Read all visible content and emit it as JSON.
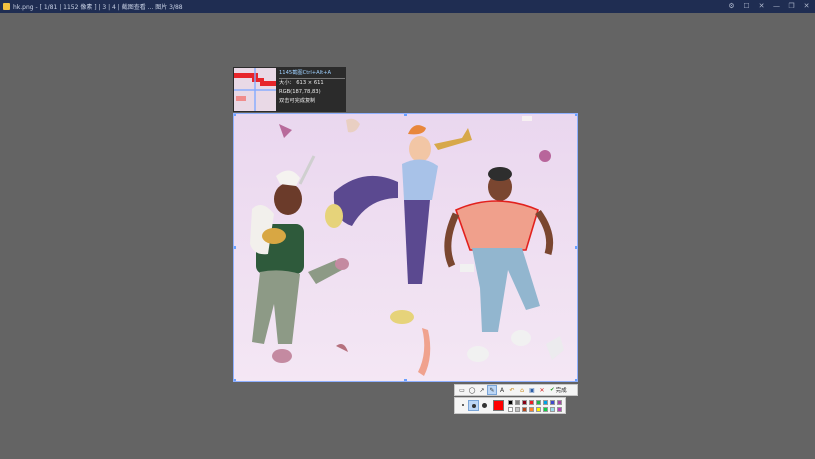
{
  "window": {
    "title": "hk.png - [ 1/81 | 1152 像素 ] | 3 | 4 | 截图查看 ... 图片 3/88",
    "controls": [
      "⚙",
      "☐",
      "✕",
      "—",
      "❐",
      "✕"
    ]
  },
  "magnifier": {
    "hint": "1145截图Ctrl+Alt+A",
    "size_label": "大小：",
    "size_width": "613",
    "size_x": "×",
    "size_height": "611",
    "rgb": "RGB(187,78,83)",
    "copy_hint": "双击可完成复制"
  },
  "toolbar": {
    "tools": [
      {
        "name": "rectangle-tool",
        "icon": "▭"
      },
      {
        "name": "ellipse-tool",
        "icon": "◯"
      },
      {
        "name": "arrow-tool",
        "icon": "↗"
      },
      {
        "name": "brush-tool",
        "icon": "✎"
      },
      {
        "name": "text-tool",
        "icon": "A"
      },
      {
        "name": "undo-tool",
        "icon": "↶"
      },
      {
        "name": "pin-tool",
        "icon": "⌂"
      },
      {
        "name": "save-tool",
        "icon": "▣"
      },
      {
        "name": "cancel-tool",
        "icon": "✕"
      }
    ],
    "active_tool": "brush-tool",
    "done_icon": "✔",
    "done_label": "完成"
  },
  "palette": {
    "current_color": "#ff0000",
    "colors": [
      "#000000",
      "#7f7f7f",
      "#880015",
      "#ed1c24",
      "#22b14c",
      "#00a2e8",
      "#3f48cc",
      "#a349a4",
      "#ffffff",
      "#c3c3c3",
      "#b5451b",
      "#ff7f27",
      "#fff200",
      "#0ed145",
      "#99d9ea",
      "#b83dba"
    ]
  }
}
